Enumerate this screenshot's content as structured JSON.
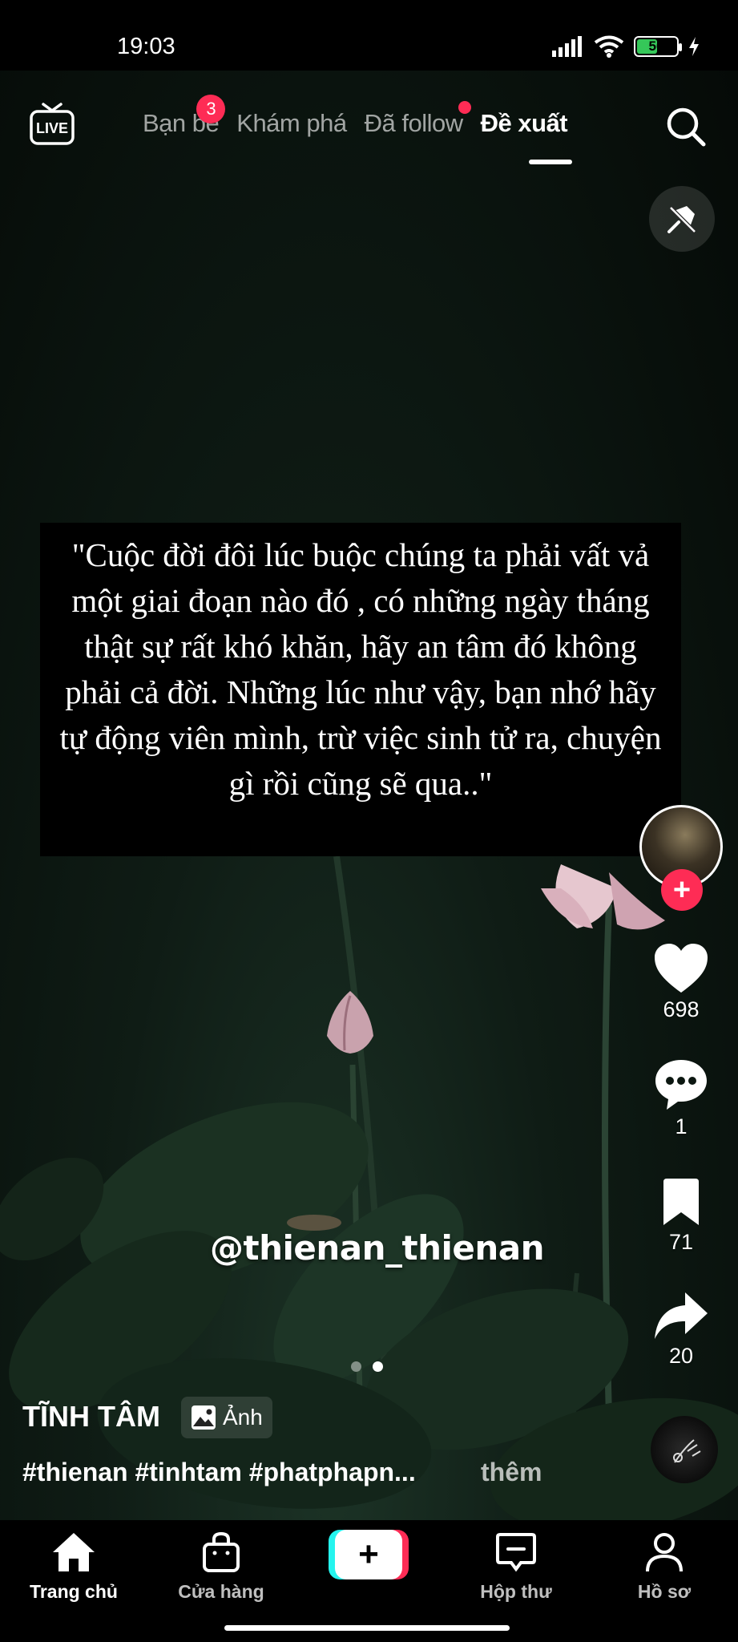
{
  "status_bar": {
    "time": "19:03",
    "battery_percent": 56,
    "battery_label": "56"
  },
  "top_nav": {
    "tabs": [
      {
        "label": "Bạn bè",
        "badge": "3"
      },
      {
        "label": "Khám phá"
      },
      {
        "label": "Đã follow",
        "dot": true
      },
      {
        "label": "Đề xuất",
        "active": true
      }
    ],
    "live_icon": "live-icon",
    "search_icon": "search-icon",
    "pin_icon": "pin-icon"
  },
  "post": {
    "quote": "\"Cuộc đời đôi lúc buộc chúng ta phải vất vả một giai đoạn nào đó , có những ngày tháng thật sự rất khó khăn, hãy an tâm đó không phải cả đời. Những lúc như vậy, bạn nhớ hãy tự động viên mình, trừ việc sinh tử ra, chuyện gì rồi cũng sẽ qua..\"",
    "watermark": "@thienan_thienan",
    "author": "TĨNH TÂM",
    "type_badge": "Ảnh",
    "caption": "#thienan #tinhtam #phatphapn...",
    "more": "thêm",
    "page_count": 2,
    "current_page": 2
  },
  "actions": {
    "follow_symbol": "+",
    "likes": "698",
    "comments": "1",
    "saves": "71",
    "shares": "20"
  },
  "bottom_nav": {
    "items": [
      {
        "label": "Trang chủ",
        "icon": "home-icon",
        "active": true
      },
      {
        "label": "Cửa hàng",
        "icon": "shop-bag-icon"
      },
      {
        "label": "",
        "icon": "create-plus-icon"
      },
      {
        "label": "Hộp thư",
        "icon": "inbox-icon"
      },
      {
        "label": "Hồ sơ",
        "icon": "profile-icon"
      }
    ],
    "create_symbol": "+"
  },
  "colors": {
    "accent": "#fe2c55",
    "cyan": "#25f4ee",
    "battery": "#35c759"
  }
}
